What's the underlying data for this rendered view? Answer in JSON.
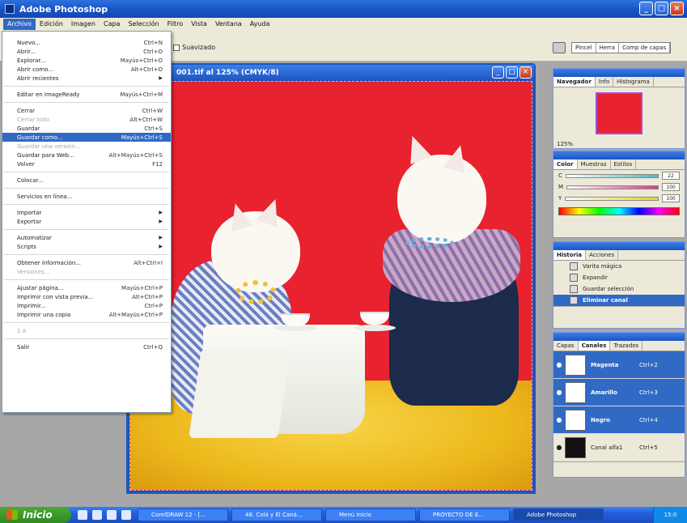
{
  "app": {
    "title": "Adobe Photoshop"
  },
  "menu": [
    "Archivo",
    "Edición",
    "Imagen",
    "Capa",
    "Selección",
    "Filtro",
    "Vista",
    "Ventana",
    "Ayuda"
  ],
  "options": {
    "checkbox_label": "Suavizado"
  },
  "palette_well": [
    "Pincel",
    "Herra",
    "Comp de capas"
  ],
  "document": {
    "title": "001.tif al 125% (CMYK/8)"
  },
  "file_menu": {
    "items": [
      {
        "label": "Nuevo...",
        "shortcut": "Ctrl+N",
        "state": "normal"
      },
      {
        "label": "Abrir...",
        "shortcut": "Ctrl+O",
        "state": "normal"
      },
      {
        "label": "Explorar...",
        "shortcut": "Mayús+Ctrl+O",
        "state": "normal"
      },
      {
        "label": "Abrir como...",
        "shortcut": "Alt+Ctrl+O",
        "state": "normal"
      },
      {
        "label": "Abrir recientes",
        "shortcut": "",
        "state": "submenu"
      },
      {
        "sep": true
      },
      {
        "label": "Editar en ImageReady",
        "shortcut": "Mayús+Ctrl+M",
        "state": "normal"
      },
      {
        "sep": true
      },
      {
        "label": "Cerrar",
        "shortcut": "Ctrl+W",
        "state": "normal"
      },
      {
        "label": "Cerrar todo",
        "shortcut": "Alt+Ctrl+W",
        "state": "disabled"
      },
      {
        "label": "Guardar",
        "shortcut": "Ctrl+S",
        "state": "normal"
      },
      {
        "label": "Guardar como...",
        "shortcut": "Mayús+Ctrl+S",
        "state": "selected"
      },
      {
        "label": "Guardar una versión...",
        "shortcut": "",
        "state": "disabled"
      },
      {
        "label": "Guardar para Web...",
        "shortcut": "Alt+Mayús+Ctrl+S",
        "state": "normal"
      },
      {
        "label": "Volver",
        "shortcut": "F12",
        "state": "normal"
      },
      {
        "sep": true
      },
      {
        "label": "Colocar...",
        "shortcut": "",
        "state": "normal"
      },
      {
        "sep": true
      },
      {
        "label": "Servicios en línea...",
        "shortcut": "",
        "state": "normal"
      },
      {
        "sep": true
      },
      {
        "label": "Importar",
        "shortcut": "",
        "state": "submenu"
      },
      {
        "label": "Exportar",
        "shortcut": "",
        "state": "submenu"
      },
      {
        "sep": true
      },
      {
        "label": "Automatizar",
        "shortcut": "",
        "state": "submenu"
      },
      {
        "label": "Scripts",
        "shortcut": "",
        "state": "submenu"
      },
      {
        "sep": true
      },
      {
        "label": "Obtener información...",
        "shortcut": "Alt+Ctrl+I",
        "state": "normal"
      },
      {
        "label": "Versiones...",
        "shortcut": "",
        "state": "disabled"
      },
      {
        "sep": true
      },
      {
        "label": "Ajustar página...",
        "shortcut": "Mayús+Ctrl+P",
        "state": "normal"
      },
      {
        "label": "Imprimir con vista previa...",
        "shortcut": "Alt+Ctrl+P",
        "state": "normal"
      },
      {
        "label": "Imprimir...",
        "shortcut": "Ctrl+P",
        "state": "normal"
      },
      {
        "label": "Imprimir una copia",
        "shortcut": "Alt+Mayús+Ctrl+P",
        "state": "normal"
      },
      {
        "sep": true
      },
      {
        "label": "1 A",
        "shortcut": "",
        "state": "disabled"
      },
      {
        "sep": true
      },
      {
        "label": "Salir",
        "shortcut": "Ctrl+Q",
        "state": "normal"
      }
    ]
  },
  "navigator": {
    "tabs": [
      "Navegador",
      "Info",
      "Histograma"
    ],
    "zoom": "125%"
  },
  "color": {
    "tabs": [
      "Color",
      "Muestras",
      "Estilos"
    ],
    "sliders": [
      {
        "label": "C",
        "value": "22",
        "color": "#4fb6c8"
      },
      {
        "label": "M",
        "value": "100",
        "color": "#d43a8a"
      },
      {
        "label": "Y",
        "value": "100",
        "color": "#e8d52a"
      }
    ]
  },
  "history": {
    "tabs": [
      "Historia",
      "Acciones"
    ],
    "items": [
      {
        "label": "Varita mágica",
        "selected": false
      },
      {
        "label": "Expandir",
        "selected": false
      },
      {
        "label": "Guardar selección",
        "selected": false
      },
      {
        "label": "Eliminar canal",
        "selected": true
      }
    ]
  },
  "channels": {
    "tabs": [
      "Capas",
      "Canales",
      "Trazados"
    ],
    "rows": [
      {
        "name": "Magenta",
        "shortcut": "Ctrl+2",
        "selected": true
      },
      {
        "name": "Amarillo",
        "shortcut": "Ctrl+3",
        "selected": true
      },
      {
        "name": "Negro",
        "shortcut": "Ctrl+4",
        "selected": true
      },
      {
        "name": "Canal alfa1",
        "shortcut": "Ctrl+5",
        "selected": false
      }
    ]
  },
  "taskbar": {
    "start": "Inicio",
    "tasks": [
      "CorelDRAW 12 - [...",
      "48. Colá y El Caná...",
      "Menú Inicio",
      "PROYECTO DE E...",
      "Adobe Photoshop"
    ],
    "tray": "15:0"
  }
}
